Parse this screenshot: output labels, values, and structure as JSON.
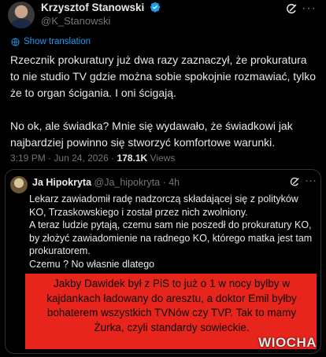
{
  "author": {
    "name": "Krzysztof Stanowski",
    "handle": "@K_Stanowski"
  },
  "translation_link": "Show translation",
  "tweet": {
    "paragraphs": [
      "Rzecznik prokuratury już dwa razy zaznaczył, że prokuratura to nie studio TV gdzie można sobie spokojnie rozmawiać, tylko że to organ ścigania. I oni ścigają.",
      "No ok, ale świadka? Mnie się wydawało, że świadkowi jak najbardziej powinno się stworzyć komfortowe warunki."
    ],
    "time": "3:19 PM",
    "date": "Jun 24, 2026",
    "separator": "·",
    "views_count": "178.1K",
    "views_label": "Views"
  },
  "quoted": {
    "name": "Ja Hipokryta",
    "handle": "@Ja_hipokryta",
    "age": "4h",
    "lines": [
      "Lekarz zawiadomił radę nadzorczą składającej się z polityków KO, Trzaskowskiego i został przez nich zwolniony.",
      "A teraz ludzie pytają, czemu sam nie poszedł do prokuratury KO, by złożyć zawiadomienie na radnego KO, którego matka jest tam prokuratorem.",
      "Czemu ? No własnie dlatego"
    ]
  },
  "overlay": {
    "text": "Jakby Dawidek był z PiS to już o 1 w nocy byłby w kajdankach ładowany do aresztu, a doktor Emil byłby bohaterem wszystkich TVNów czy TVP.  Tak to mamy Żurka, czyli standardy sowieckie.",
    "watermark": "WIOCHA",
    "color": "#e8251c"
  },
  "icons": {
    "verified": "verified-badge-icon",
    "grok": "grok-icon",
    "more": "more-icon",
    "globe": "globe-icon"
  },
  "colors": {
    "background": "#000000",
    "link": "#1d9bf0",
    "secondary_text": "#71767b"
  }
}
